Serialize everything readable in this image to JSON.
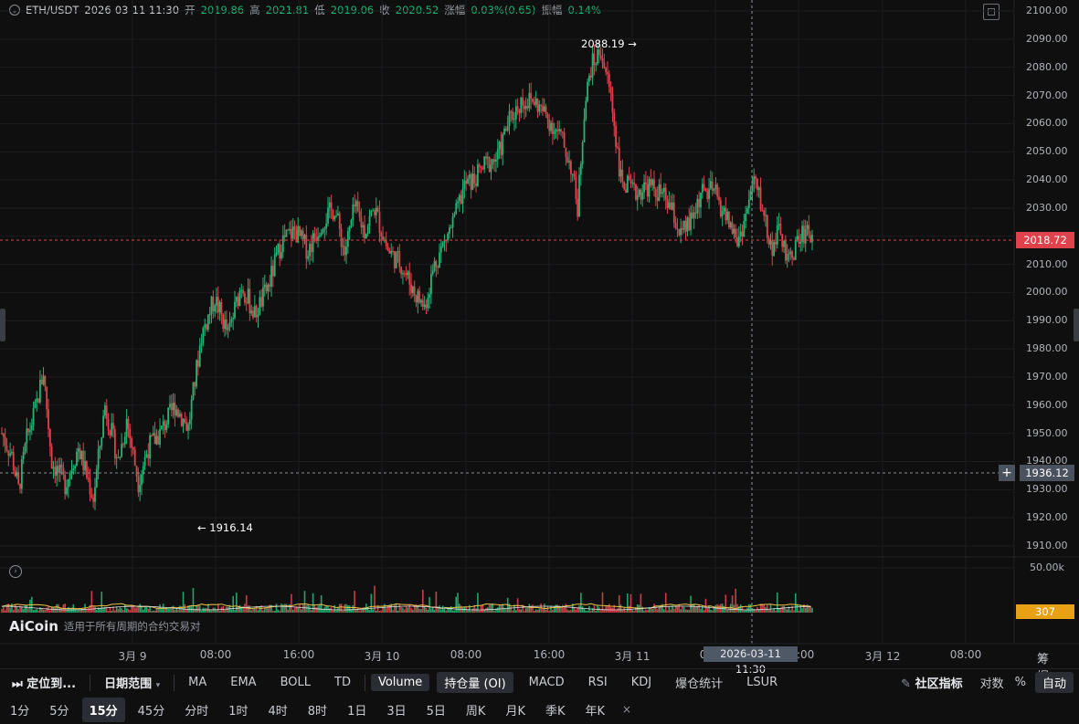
{
  "header": {
    "symbol": "ETH/USDT",
    "datetime": "2026-03-11 11:30",
    "open_label": "开",
    "open": "2019.86",
    "high_label": "高",
    "high": "2021.81",
    "low_label": "低",
    "low": "2019.06",
    "close_label": "收",
    "close": "2020.52",
    "change_label": "涨幅",
    "change": "0.03%(0.65)",
    "amplitude_label": "振幅",
    "amplitude": "0.14%"
  },
  "y_ticks": [
    "2100.00",
    "2090.00",
    "2080.00",
    "2070.00",
    "2060.00",
    "2050.00",
    "2040.00",
    "2030.00",
    "2020.00",
    "2010.00",
    "2000.00",
    "1990.00",
    "1980.00",
    "1970.00",
    "1960.00",
    "1950.00",
    "1940.00",
    "1930.00",
    "1920.00",
    "1910.00"
  ],
  "x_ticks": [
    "3月 9",
    "08:00",
    "16:00",
    "3月 10",
    "08:00",
    "16:00",
    "3月 11",
    "08:00",
    "16:00",
    "3月 12",
    "08:00"
  ],
  "current_price": "2018.72",
  "crosshair_price": "1936.12",
  "crosshair_time": "2026-03-11 11:30",
  "high_marker": "2088.19 →",
  "low_marker": "← 1916.14",
  "volume": {
    "max_label": "50.00k",
    "current": "307"
  },
  "watermark": {
    "logo": "AiCoin",
    "text": "适用于所有周期的合约交易对"
  },
  "right_labels": "筹 爆",
  "colors": {
    "up": "#22b573",
    "down": "#e0424b",
    "price_badge": "#e0424b",
    "volume_badge": "#e8a115",
    "background": "#0f0f10"
  },
  "toolbar1": {
    "locate": "定位到...",
    "date_range": "日期范围",
    "indicators": [
      "MA",
      "EMA",
      "BOLL",
      "TD"
    ],
    "sub_indicators": [
      "Volume",
      "持仓量 (OI)",
      "MACD",
      "RSI",
      "KDJ",
      "爆仓统计",
      "LSUR"
    ],
    "community": "社区指标",
    "log": "对数",
    "percent": "%",
    "auto": "自动"
  },
  "toolbar2": {
    "intervals": [
      "1分",
      "5分",
      "15分",
      "45分",
      "分时",
      "1时",
      "4时",
      "8时",
      "1日",
      "3日",
      "5日",
      "周K",
      "月K",
      "季K",
      "年K"
    ],
    "selected": "15分",
    "close": "×"
  },
  "chart_data": {
    "type": "candlestick",
    "symbol": "ETH/USDT",
    "interval": "15分",
    "ylim": [
      1905,
      2103
    ],
    "x_ticks": [
      "3月 9",
      "08:00",
      "16:00",
      "3月 10",
      "08:00",
      "16:00",
      "3月 11",
      "08:00",
      "16:00",
      "3月 12",
      "08:00"
    ],
    "waypoints": [
      [
        0,
        1950
      ],
      [
        6,
        1942
      ],
      [
        10,
        1930
      ],
      [
        15,
        1948
      ],
      [
        20,
        1958
      ],
      [
        25,
        1972
      ],
      [
        30,
        1940
      ],
      [
        38,
        1932
      ],
      [
        46,
        1945
      ],
      [
        55,
        1927
      ],
      [
        62,
        1960
      ],
      [
        70,
        1940
      ],
      [
        75,
        1955
      ],
      [
        82,
        1933
      ],
      [
        88,
        1945
      ],
      [
        95,
        1950
      ],
      [
        104,
        1960
      ],
      [
        112,
        1952
      ],
      [
        120,
        1985
      ],
      [
        128,
        1998
      ],
      [
        136,
        1985
      ],
      [
        144,
        2003
      ],
      [
        152,
        1992
      ],
      [
        160,
        2002
      ],
      [
        168,
        2018
      ],
      [
        176,
        2022
      ],
      [
        184,
        2015
      ],
      [
        192,
        2025
      ],
      [
        200,
        2030
      ],
      [
        206,
        2014
      ],
      [
        212,
        2030
      ],
      [
        218,
        2022
      ],
      [
        224,
        2030
      ],
      [
        232,
        2015
      ],
      [
        240,
        2010
      ],
      [
        248,
        2000
      ],
      [
        254,
        1995
      ],
      [
        260,
        2010
      ],
      [
        266,
        2018
      ],
      [
        272,
        2026
      ],
      [
        278,
        2038
      ],
      [
        284,
        2040
      ],
      [
        290,
        2045
      ],
      [
        298,
        2048
      ],
      [
        304,
        2060
      ],
      [
        312,
        2068
      ],
      [
        320,
        2068
      ],
      [
        328,
        2062
      ],
      [
        336,
        2055
      ],
      [
        342,
        2045
      ],
      [
        346,
        2030
      ],
      [
        350,
        2065
      ],
      [
        354,
        2080
      ],
      [
        360,
        2086
      ],
      [
        366,
        2070
      ],
      [
        372,
        2040
      ],
      [
        380,
        2035
      ],
      [
        388,
        2038
      ],
      [
        396,
        2035
      ],
      [
        402,
        2030
      ],
      [
        408,
        2020
      ],
      [
        414,
        2025
      ],
      [
        420,
        2035
      ],
      [
        428,
        2036
      ],
      [
        434,
        2028
      ],
      [
        438,
        2024
      ],
      [
        442,
        2018
      ],
      [
        446,
        2025
      ],
      [
        452,
        2040
      ],
      [
        458,
        2028
      ],
      [
        462,
        2016
      ],
      [
        468,
        2022
      ],
      [
        472,
        2010
      ],
      [
        478,
        2018
      ],
      [
        484,
        2023
      ],
      [
        487,
        2020
      ]
    ],
    "last_close": 2020.52
  }
}
